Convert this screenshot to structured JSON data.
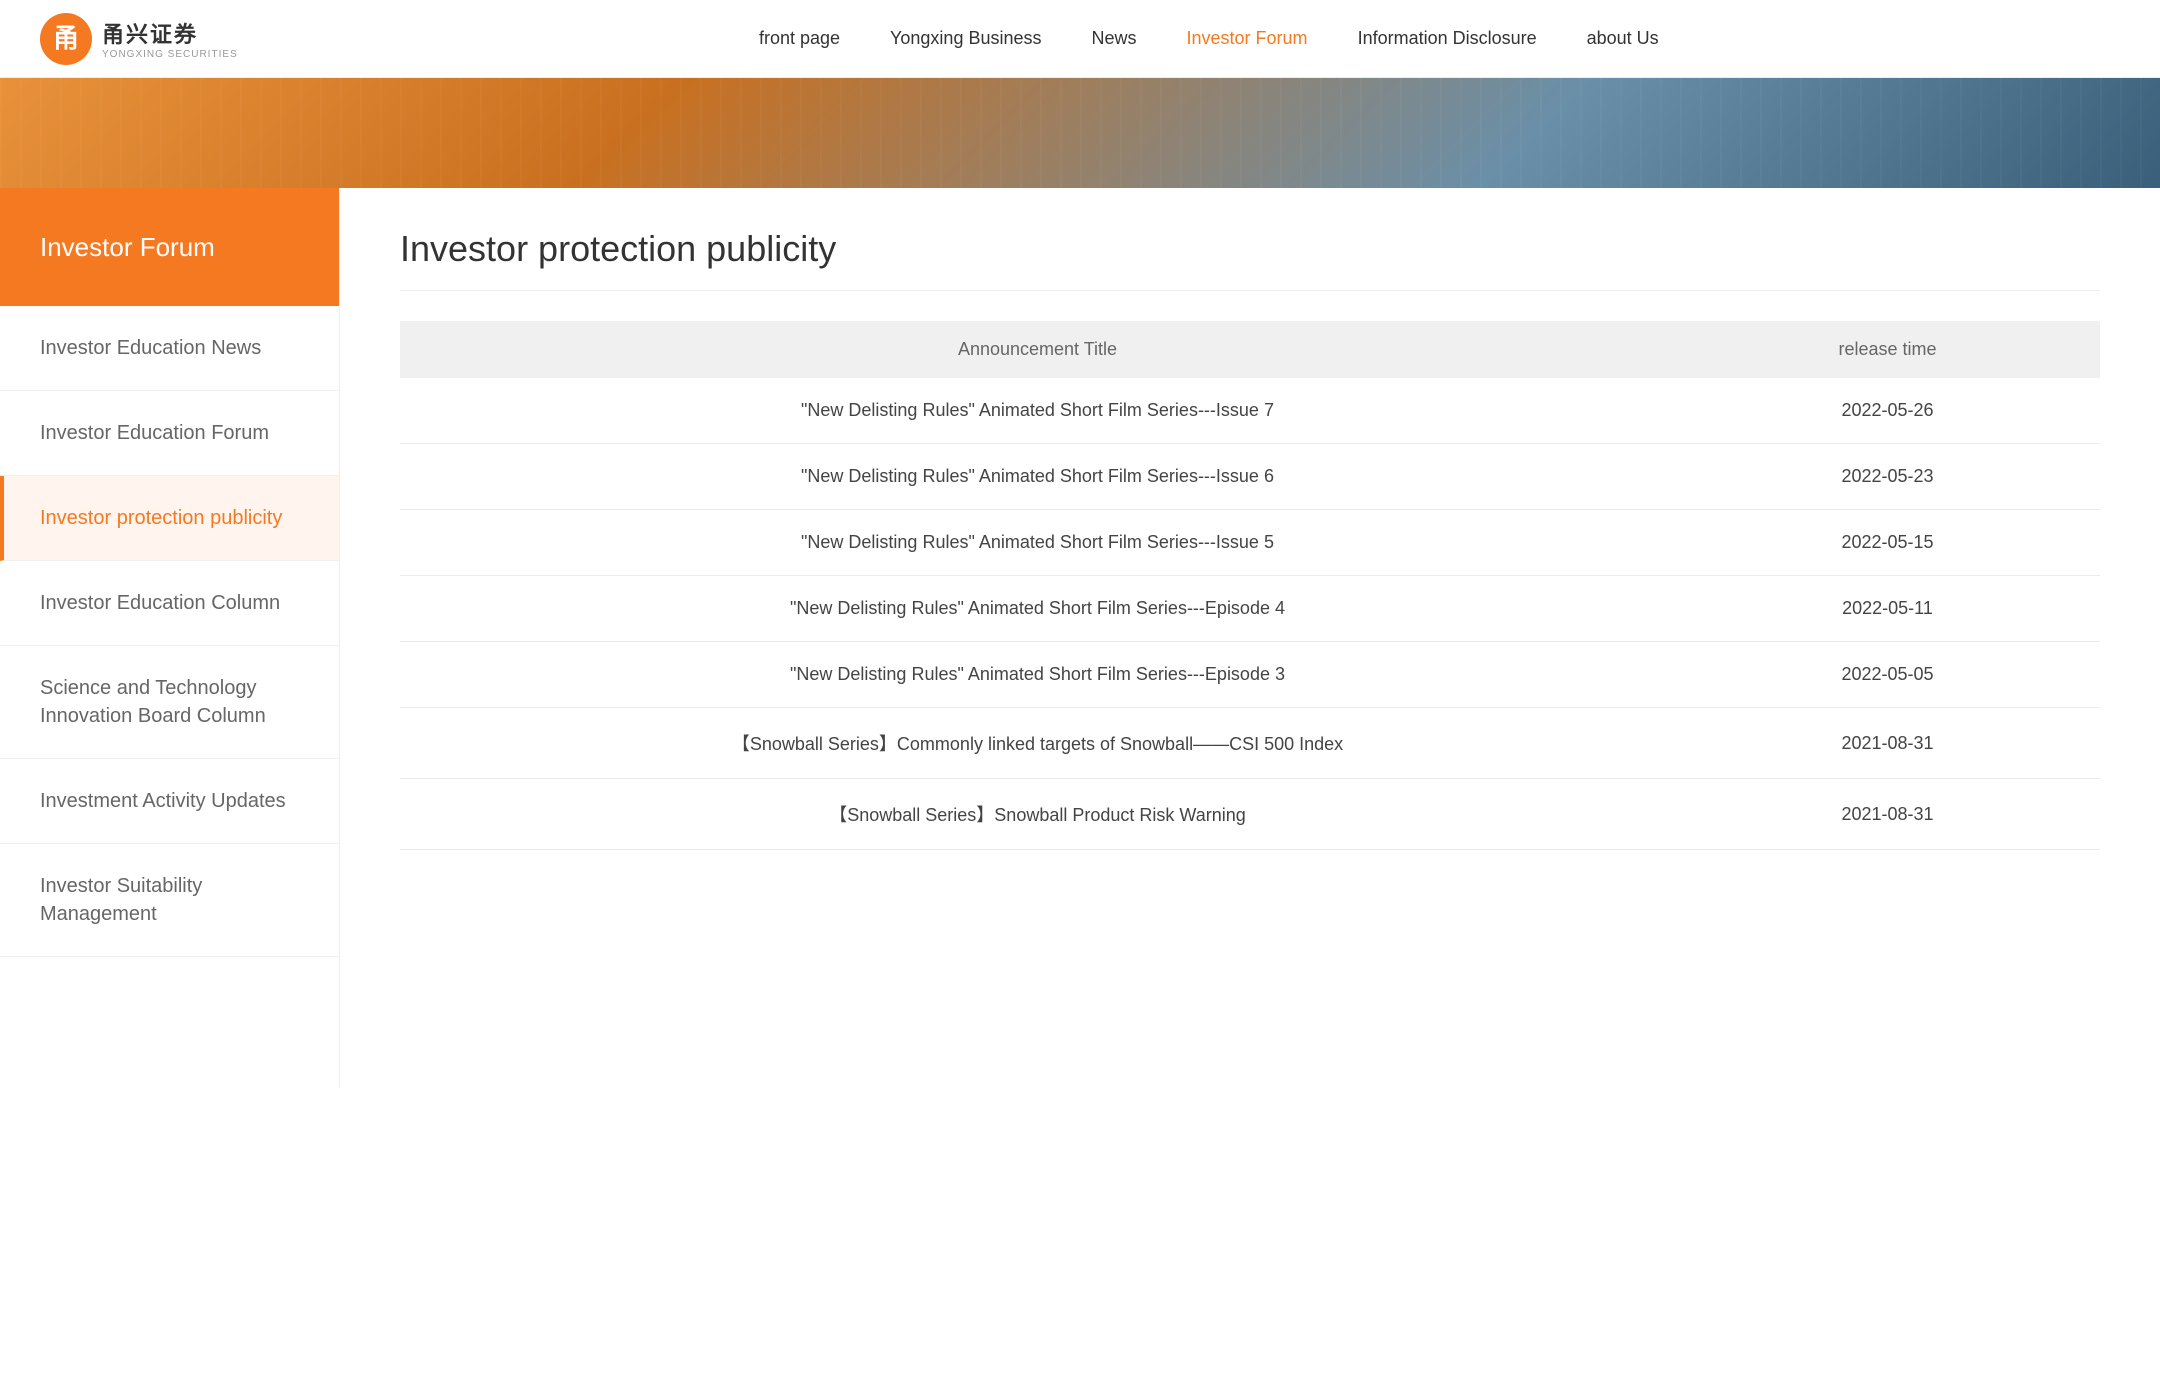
{
  "header": {
    "logo_cn": "甬兴证券",
    "logo_en": "YONGXING SECURITIES",
    "nav_items": [
      {
        "id": "front-page",
        "label": "front page",
        "active": false
      },
      {
        "id": "yongxing-business",
        "label": "Yongxing Business",
        "active": false
      },
      {
        "id": "news",
        "label": "News",
        "active": false
      },
      {
        "id": "investor-forum",
        "label": "Investor Forum",
        "active": true
      },
      {
        "id": "information-disclosure",
        "label": "Information Disclosure",
        "active": false
      },
      {
        "id": "about-us",
        "label": "about Us",
        "active": false
      }
    ]
  },
  "sidebar": {
    "header_label": "Investor Forum",
    "menu_items": [
      {
        "id": "investor-education-news",
        "label": "Investor Education News",
        "active": false
      },
      {
        "id": "investor-education-forum",
        "label": "Investor Education Forum",
        "active": false
      },
      {
        "id": "investor-protection-publicity",
        "label": "Investor protection publicity",
        "active": true
      },
      {
        "id": "investor-education-column",
        "label": "Investor Education Column",
        "active": false
      },
      {
        "id": "science-technology-board",
        "label": "Science and Technology Innovation Board Column",
        "active": false
      },
      {
        "id": "investment-activity",
        "label": "Investment Activity Updates",
        "active": false
      },
      {
        "id": "investor-suitability",
        "label": "Investor Suitability Management",
        "active": false
      }
    ]
  },
  "content": {
    "page_title": "Investor protection publicity",
    "table": {
      "col_title": "Announcement Title",
      "col_release": "release time",
      "rows": [
        {
          "title": "\"New Delisting Rules\" Animated Short Film Series---Issue 7",
          "date": "2022-05-26"
        },
        {
          "title": "\"New Delisting Rules\" Animated Short Film Series---Issue 6",
          "date": "2022-05-23"
        },
        {
          "title": "\"New Delisting Rules\" Animated Short Film Series---Issue 5",
          "date": "2022-05-15"
        },
        {
          "title": "\"New Delisting Rules\" Animated Short Film Series---Episode 4",
          "date": "2022-05-11"
        },
        {
          "title": "\"New Delisting Rules\" Animated Short Film Series---Episode 3",
          "date": "2022-05-05"
        },
        {
          "title": "【Snowball Series】Commonly linked targets of Snowball——CSI 500 Index",
          "date": "2021-08-31"
        },
        {
          "title": "【Snowball Series】Snowball Product Risk Warning",
          "date": "2021-08-31"
        }
      ]
    }
  },
  "colors": {
    "orange": "#F47920",
    "active_bg": "#fff5ee"
  }
}
